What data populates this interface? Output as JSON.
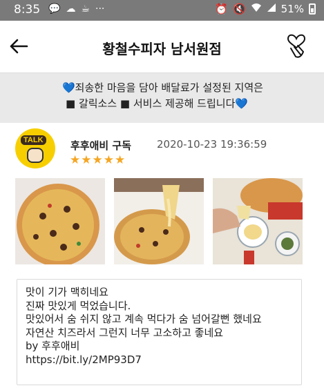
{
  "status": {
    "time": "8:35",
    "battery": "51%"
  },
  "header": {
    "title": "황철수피자 남서원점"
  },
  "notice": {
    "line1": "💙죄송한 마음을 담아 배달료가 설정된 지역은",
    "line2": "■ 갈릭소스 ■ 서비스 제공해 드립니다💙"
  },
  "review": {
    "username": "후후애비 구독",
    "datetime": "2020-10-23 19:36:59",
    "rating": 5,
    "stars": "★★★★★",
    "avatar_badge": "TALK",
    "lines": [
      "맛이 기가 맥히네요",
      "진짜 맛있게 먹었습니다.",
      "맛있어서 숨 쉬지 않고 계속 먹다가 숨 넘어갈뻔 했네요",
      "자연산 치즈라서 그런지 너무 고소하고 좋네요",
      "by 후후애비",
      "https://bit.ly/2MP93D7"
    ]
  },
  "colors": {
    "statusbar": "#7a7a7a",
    "notice_bg": "#e9e9e9",
    "star": "#f5a623",
    "avatar_bg": "#f7cf00"
  },
  "icons": {
    "back": "arrow-left-icon",
    "heart": "finger-heart-icon"
  }
}
